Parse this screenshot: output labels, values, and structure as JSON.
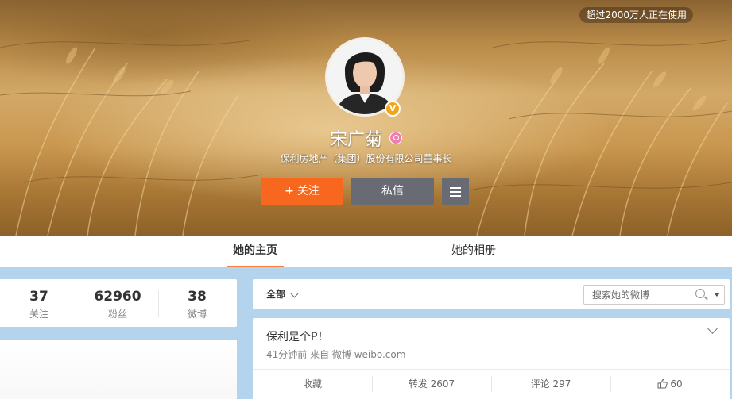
{
  "cover": {
    "user_count_text": "超过2000万人正在使用",
    "name": "宋广菊",
    "title": "保利房地产（集团）股份有限公司董事长",
    "follow_label": "关注",
    "message_label": "私信"
  },
  "tabs": {
    "home": "她的主页",
    "album": "她的相册"
  },
  "stats": {
    "following_num": "37",
    "following_label": "关注",
    "fans_num": "62960",
    "fans_label": "粉丝",
    "weibo_num": "38",
    "weibo_label": "微博"
  },
  "feed": {
    "filter_label": "全部",
    "search_placeholder": "搜索她的微博",
    "post": {
      "text": "保利是个P！",
      "meta": "41分钟前 来自 微博 weibo.com",
      "collect_label": "收藏",
      "repost_label": "转发 2607",
      "comment_label": "评论 297",
      "like_count": "60"
    }
  },
  "colors": {
    "follow_button": "#f7671d",
    "secondary_button": "#686b74",
    "tab_underline": "#fa7d3c",
    "page_background": "#b3d4ec",
    "verified_badge": "#f2a41b"
  }
}
